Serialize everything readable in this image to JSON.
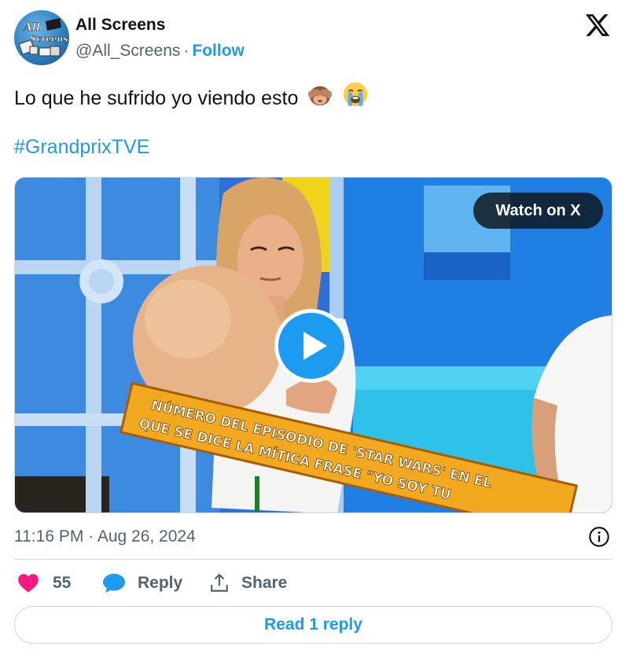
{
  "author": {
    "name": "All Screens",
    "handle": "@All_Screens",
    "separator": "·",
    "follow_label": "Follow",
    "avatar_text": [
      "All",
      "Screens"
    ]
  },
  "tweet": {
    "text": "Lo que he sufrido yo viendo esto",
    "emojis": [
      "see-no-evil-monkey",
      "loudly-crying-face"
    ],
    "hashtag": "#GrandprixTVE"
  },
  "media": {
    "watch_label": "Watch on X",
    "caption_lines": [
      "NÚMERO DEL EPISODIO DE 'STAR WARS' EN EL",
      "QUE SE DICE LA MÍTICA FRASE \"YO SOY TU"
    ]
  },
  "meta": {
    "timestamp": "11:16 PM · Aug 26, 2024"
  },
  "actions": {
    "like_count": "55",
    "reply_label": "Reply",
    "share_label": "Share",
    "read_replies_label": "Read 1 reply"
  },
  "colors": {
    "accent": "#1d9bf0",
    "like": "#f91880",
    "muted_text": "#536471",
    "border": "#cfd9de"
  },
  "icons": [
    "x-logo-icon",
    "play-icon",
    "info-icon",
    "heart-icon",
    "reply-bubble-icon",
    "share-icon"
  ]
}
